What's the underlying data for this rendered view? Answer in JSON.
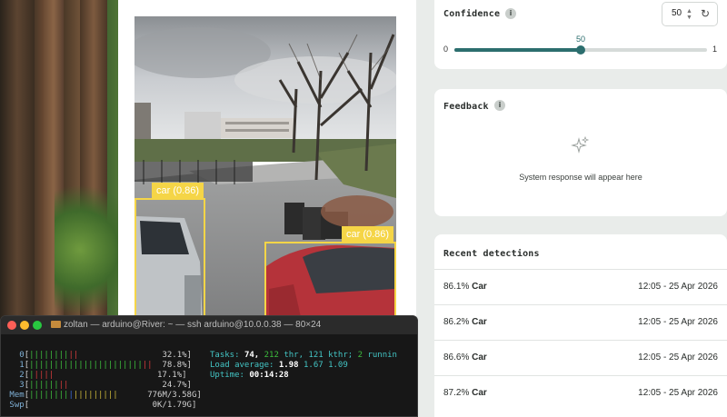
{
  "image_panel": {
    "detections": [
      {
        "label": "car (0.86)"
      },
      {
        "label": "car (0.86)"
      }
    ]
  },
  "confidence": {
    "title": "Confidence",
    "info": "i",
    "value": "50",
    "slider_value": 50,
    "slider_label": "50",
    "min": "0",
    "max": "1",
    "reset_icon": "refresh-icon"
  },
  "feedback": {
    "title": "Feedback",
    "info": "i",
    "placeholder": "System response will appear here"
  },
  "recent": {
    "title": "Recent detections",
    "rows": [
      {
        "conf": "86.1%",
        "label": "Car",
        "time": "12:05 - 25 Apr 2026"
      },
      {
        "conf": "86.2%",
        "label": "Car",
        "time": "12:05 - 25 Apr 2026"
      },
      {
        "conf": "86.6%",
        "label": "Car",
        "time": "12:05 - 25 Apr 2026"
      },
      {
        "conf": "87.2%",
        "label": "Car",
        "time": "12:05 - 25 Apr 2026"
      }
    ]
  },
  "terminal": {
    "title": "zoltan — arduino@River: ~ — ssh arduino@10.0.0.38 — 80×24",
    "cpus": [
      {
        "id": "0",
        "pct": "32.1%"
      },
      {
        "id": "1",
        "pct": "78.8%"
      },
      {
        "id": "2",
        "pct": "17.1%"
      },
      {
        "id": "3",
        "pct": "24.7%"
      }
    ],
    "mem": {
      "label": "Mem",
      "value": "776M/3.58G"
    },
    "swp": {
      "label": "Swp",
      "value": "0K/1.79G"
    },
    "tasks_label": "Tasks:",
    "tasks": "74,",
    "thr": "212",
    "thr_label": "thr,",
    "kthr": "121 kthr;",
    "running": "2",
    "running_label": "runnin",
    "load_label": "Load average:",
    "load1": "1.98",
    "load5": "1.67",
    "load15": "1.09",
    "uptime_label": "Uptime:",
    "uptime": "00:14:28"
  }
}
